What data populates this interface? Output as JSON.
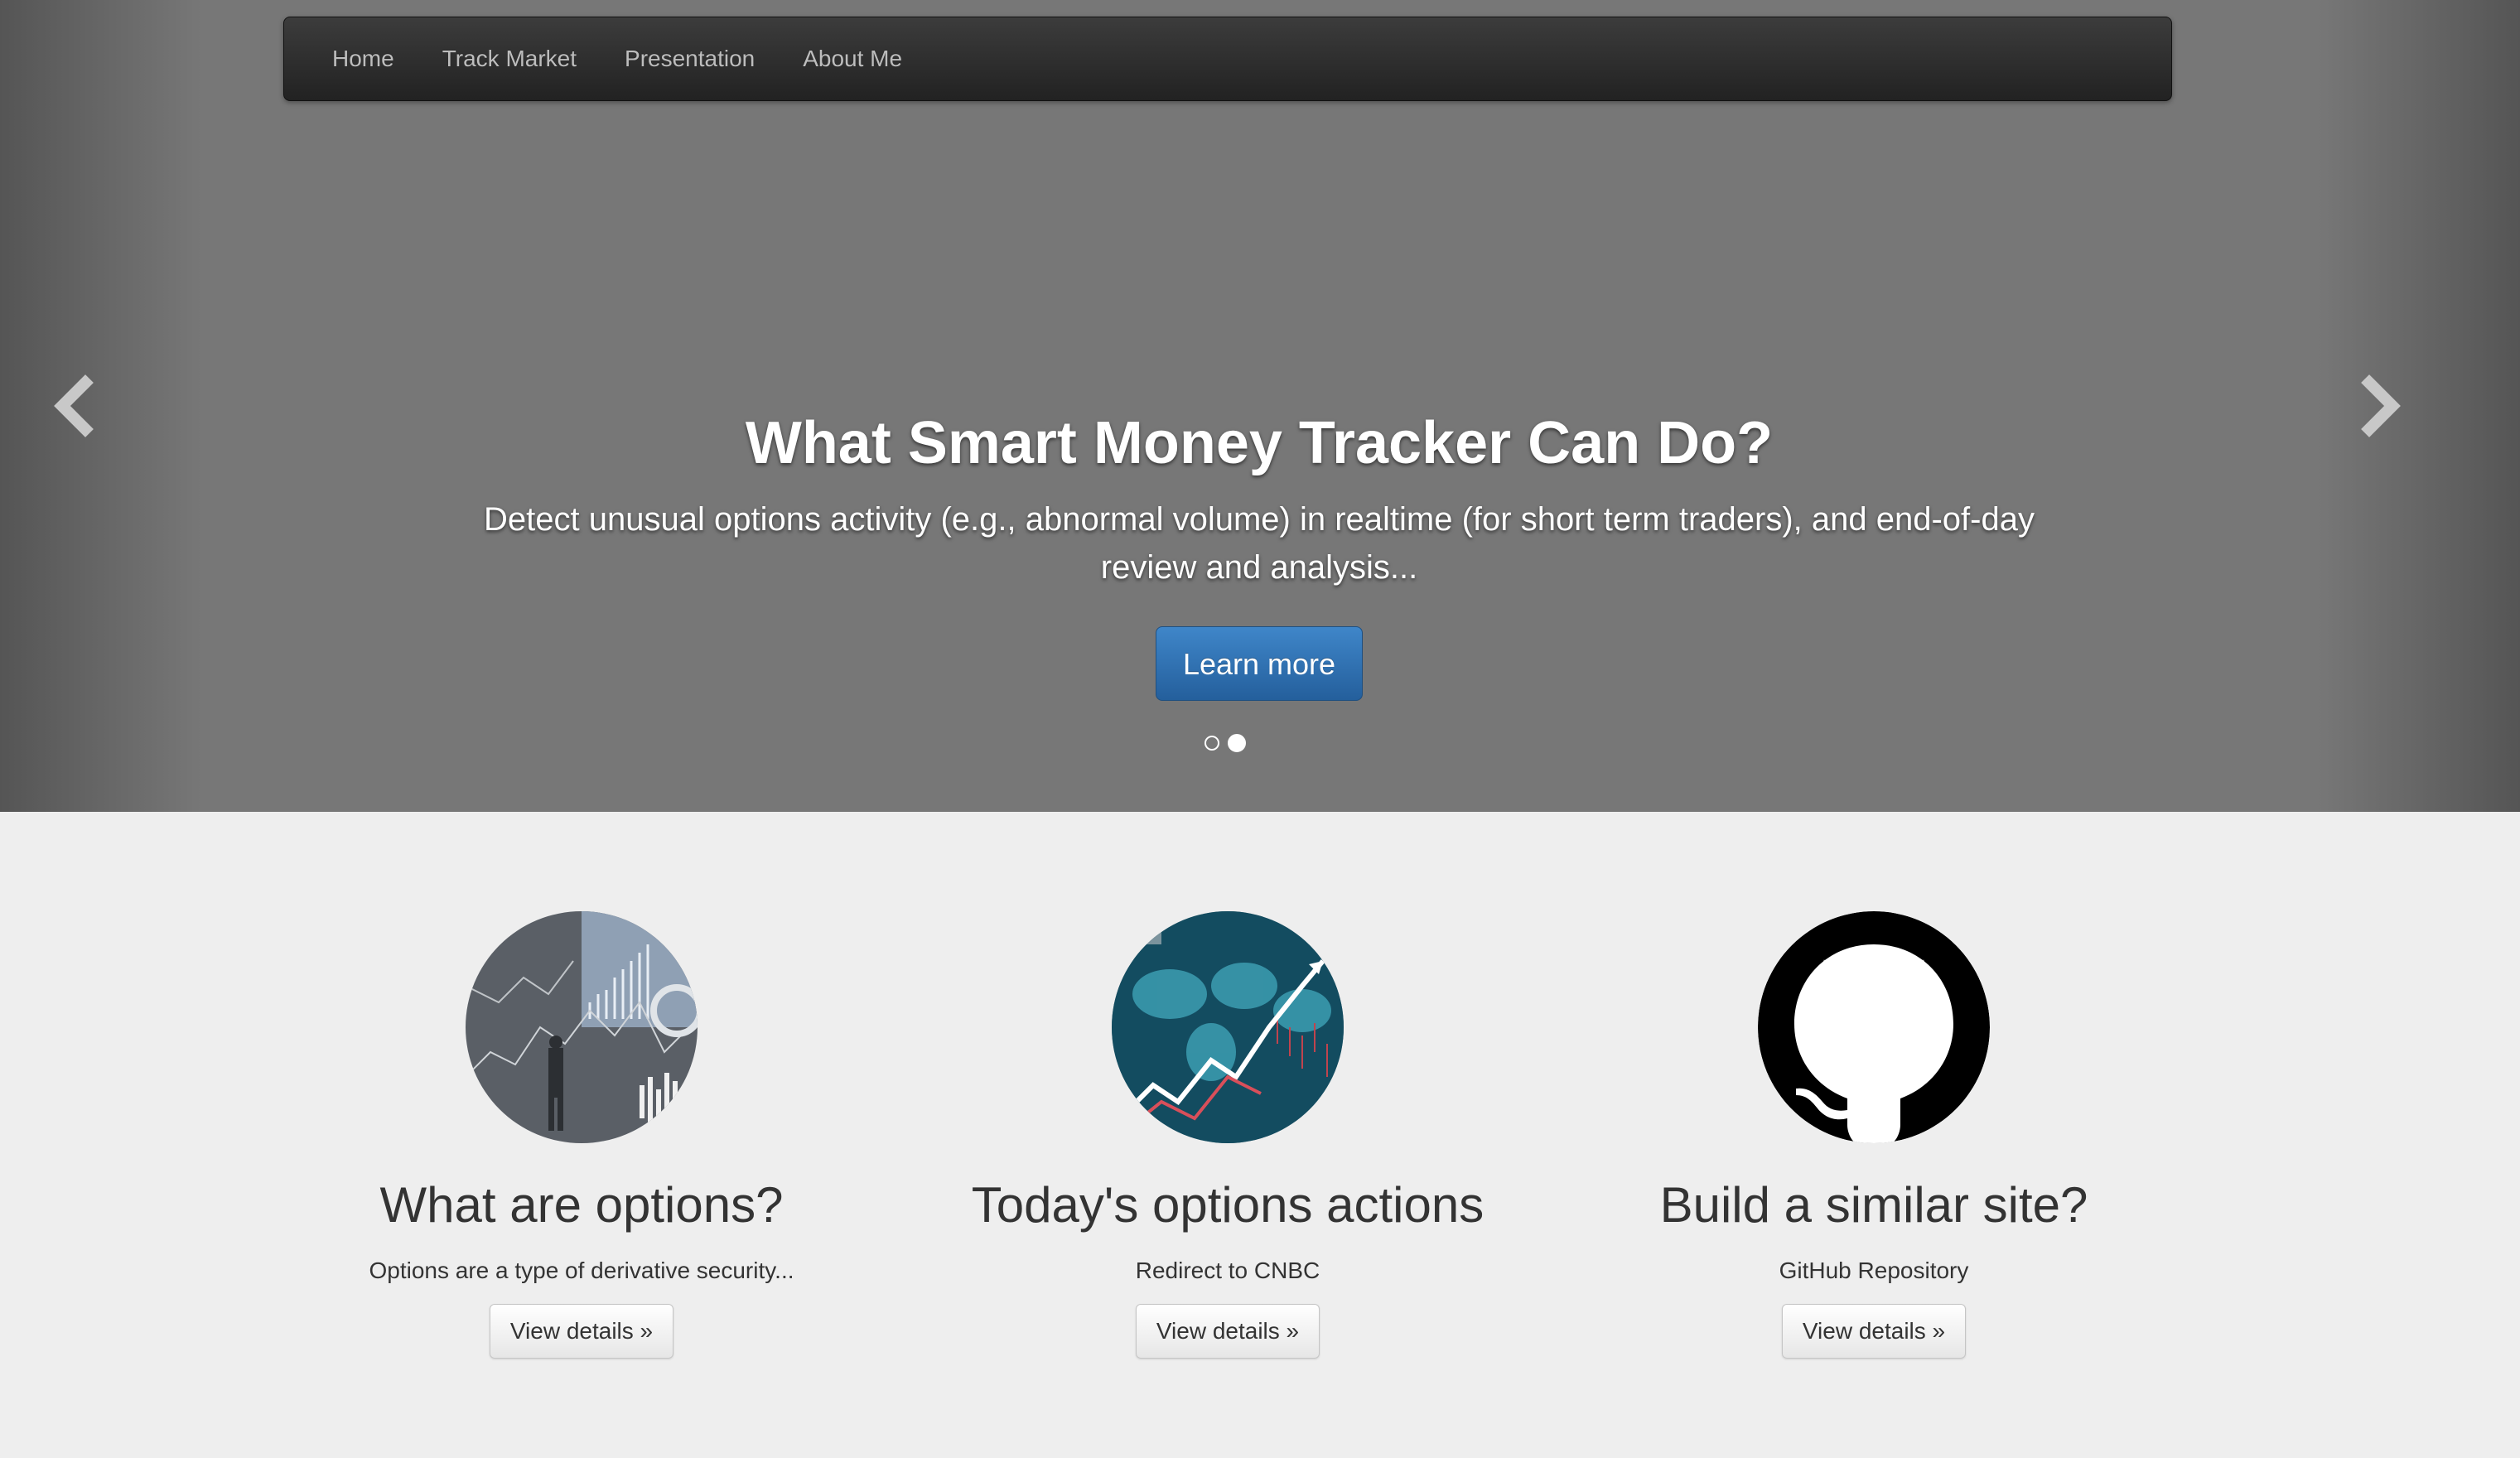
{
  "nav": {
    "items": [
      {
        "label": "Home"
      },
      {
        "label": "Track Market"
      },
      {
        "label": "Presentation"
      },
      {
        "label": "About Me"
      }
    ]
  },
  "hero": {
    "title": "What Smart Money Tracker Can Do?",
    "description": "Detect unusual options activity (e.g., abnormal volume) in realtime (for short term traders), and end-of-day review and analysis...",
    "button_label": "Learn more",
    "slide_count": 2,
    "active_slide": 2
  },
  "features": [
    {
      "title": "What are options?",
      "text": "Options are a type of derivative security...",
      "button_label": "View details »",
      "image": "finance-chart-businessman-image"
    },
    {
      "title": "Today's options actions",
      "text": "Redirect to CNBC",
      "button_label": "View details »",
      "image": "stock-market-world-map-image"
    },
    {
      "title": "Build a similar site?",
      "text": "GitHub Repository",
      "button_label": "View details »",
      "image": "github-octocat-logo"
    }
  ],
  "colors": {
    "primary_button": "#2e6fb0",
    "navbar": "#2b2b2b",
    "hero_bg": "#777777",
    "page_bg": "#eeeeee"
  }
}
